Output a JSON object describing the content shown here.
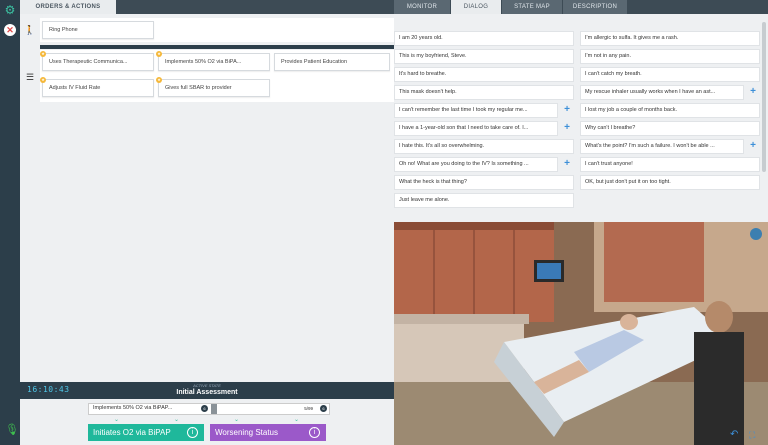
{
  "left_tabs": {
    "orders_actions": "ORDERS & ACTIONS"
  },
  "orders": {
    "row1": [
      {
        "label": "Ring Phone"
      }
    ],
    "row2": [
      {
        "label": "Uses Therapeutic Communica..."
      },
      {
        "label": "Implements 50% O2 via BiPA..."
      },
      {
        "label": "Provides Patient Education"
      },
      {
        "label": "Adjusts IV Fluid Rate"
      },
      {
        "label": "Gives full SBAR to provider"
      }
    ]
  },
  "state": {
    "clock": "16:10:43",
    "active_label": "ACTIVE STATE",
    "name": "Initial Assessment"
  },
  "transition": {
    "progress_text": "Implements 50% O2 via BiPAP...",
    "progress_value": "5/99",
    "buttons": [
      {
        "label": "Initiates O2 via BiPAP",
        "color": "#1fb89b"
      },
      {
        "label": "Worsening Status",
        "color": "#9b59c9"
      }
    ]
  },
  "right_tabs": [
    {
      "label": "MONITOR"
    },
    {
      "label": "DIALOG",
      "active": true
    },
    {
      "label": "STATE MAP"
    },
    {
      "label": "DESCRIPTION"
    }
  ],
  "dialog": {
    "left": [
      "I am 20 years old.",
      "This is my boyfriend, Steve.",
      "It's hard to breathe.",
      "This mask doesn't help.",
      "I can't remember the last time I took my regular me...",
      "I have a 1-year-old son that I need to take care of. I...",
      "I hate this. It's all so overwhelming.",
      "Oh no! What are you doing to the IV? Is something ...",
      "What the heck is that thing?",
      "Just leave me alone."
    ],
    "right": [
      "I'm allergic to sulfa. It gives me a rash.",
      "I'm not in any pain.",
      "I can't catch my breath.",
      "My rescue inhaler usually works when I have an ast...",
      "I lost my job a couple of months back.",
      "Why can't I breathe?",
      "What's the point? I'm such a failure. I won't be able ...",
      "I can't trust anyone!",
      "OK, but just don't put it on too tight."
    ]
  },
  "colors": {
    "accent": "#3cc3a3",
    "rail": "#2c3e4a",
    "plus": "#3c8fd8"
  }
}
